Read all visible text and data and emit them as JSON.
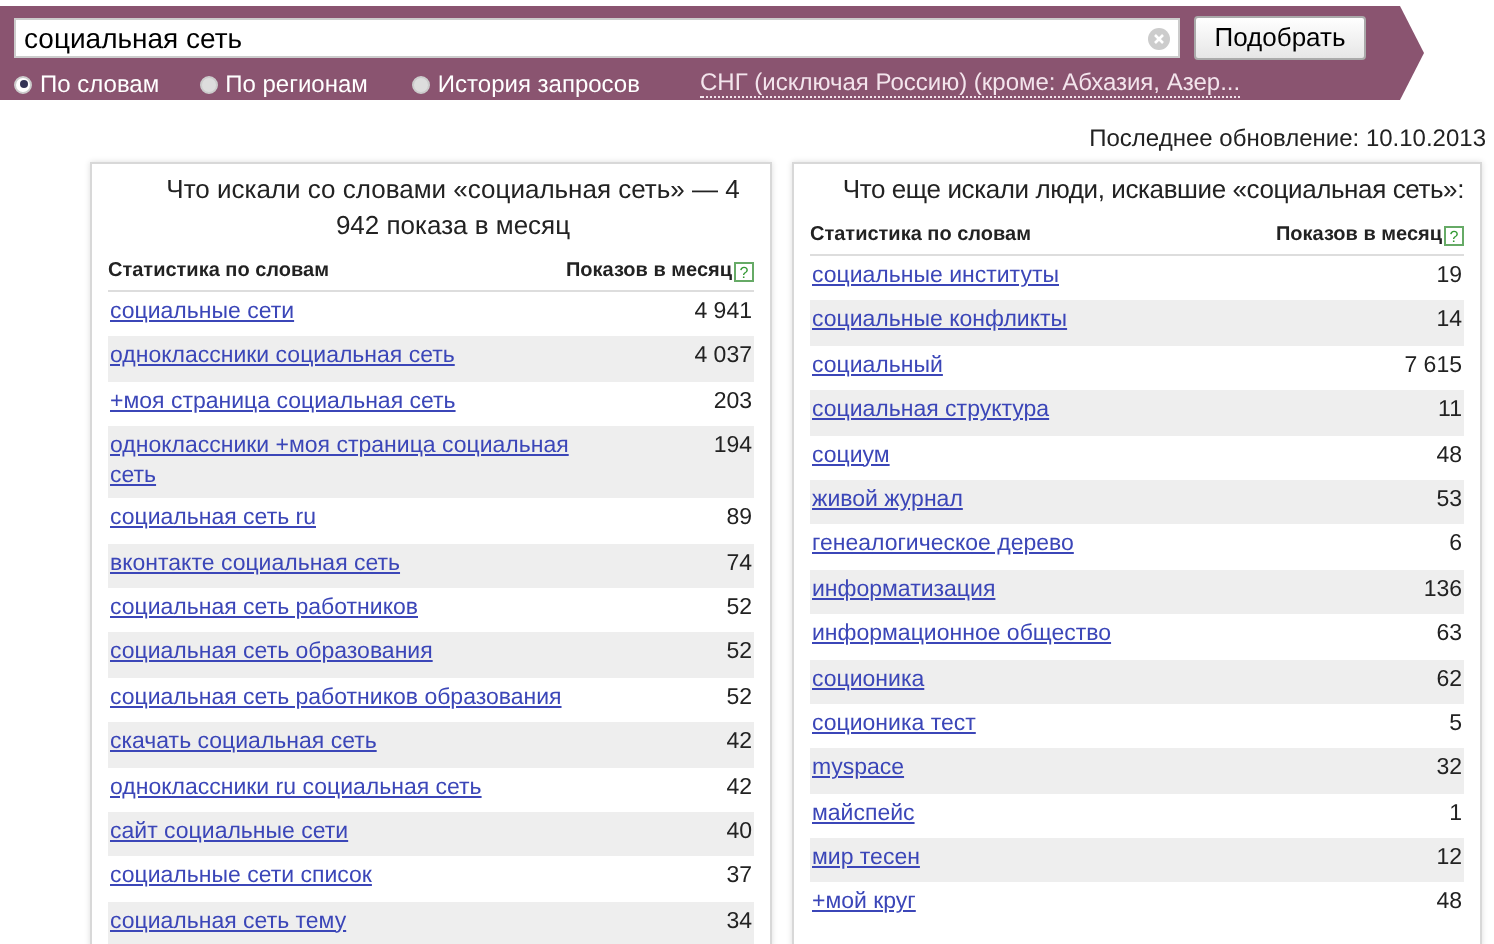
{
  "search": {
    "value": "социальная сеть",
    "button": "Подобрать"
  },
  "modes": [
    {
      "label": "По словам",
      "selected": true
    },
    {
      "label": "По регионам",
      "selected": false
    },
    {
      "label": "История запросов",
      "selected": false
    }
  ],
  "region": "СНГ (исключая Россию) (кроме: Абхазия, Азер...",
  "last_update": "Последнее обновление: 10.10.2013",
  "panels": [
    {
      "title": "Что искали со словами «социальная сеть» — 4 942 показа в месяц",
      "columns": [
        "Статистика по словам",
        "Показов в месяц"
      ],
      "help": "?",
      "rows": [
        {
          "phrase": "социальные сети",
          "count": "4 941"
        },
        {
          "phrase": "одноклассники социальная сеть",
          "count": "4 037"
        },
        {
          "phrase": "+моя страница социальная сеть",
          "count": "203"
        },
        {
          "phrase": "одноклассники +моя страница социальная сеть",
          "count": "194"
        },
        {
          "phrase": "социальная сеть ru",
          "count": "89"
        },
        {
          "phrase": "вконтакте социальная сеть",
          "count": "74"
        },
        {
          "phrase": "социальная сеть работников",
          "count": "52"
        },
        {
          "phrase": "социальная сеть образования",
          "count": "52"
        },
        {
          "phrase": "социальная сеть работников образования",
          "count": "52"
        },
        {
          "phrase": "скачать социальная сеть",
          "count": "42"
        },
        {
          "phrase": "одноклассники ru социальная сеть",
          "count": "42"
        },
        {
          "phrase": "сайт социальные сети",
          "count": "40"
        },
        {
          "phrase": "социальные сети список",
          "count": "37"
        },
        {
          "phrase": "социальная сеть тему",
          "count": "34"
        }
      ]
    },
    {
      "title": "Что еще искали люди, искавшие «социальная сеть»:",
      "columns": [
        "Статистика по словам",
        "Показов в месяц"
      ],
      "help": "?",
      "rows": [
        {
          "phrase": "социальные институты",
          "count": "19"
        },
        {
          "phrase": "социальные конфликты",
          "count": "14"
        },
        {
          "phrase": "социальный",
          "count": "7 615"
        },
        {
          "phrase": "социальная структура",
          "count": "11"
        },
        {
          "phrase": "социум",
          "count": "48"
        },
        {
          "phrase": "живой журнал",
          "count": "53"
        },
        {
          "phrase": "генеалогическое дерево",
          "count": "6"
        },
        {
          "phrase": "информатизация",
          "count": "136"
        },
        {
          "phrase": "информационное общество",
          "count": "63"
        },
        {
          "phrase": "соционика",
          "count": "62"
        },
        {
          "phrase": "соционика тест",
          "count": "5"
        },
        {
          "phrase": "myspace",
          "count": "32"
        },
        {
          "phrase": "майспейс",
          "count": "1"
        },
        {
          "phrase": "мир тесен",
          "count": "12"
        },
        {
          "phrase": "+мой круг",
          "count": "48"
        }
      ]
    }
  ]
}
